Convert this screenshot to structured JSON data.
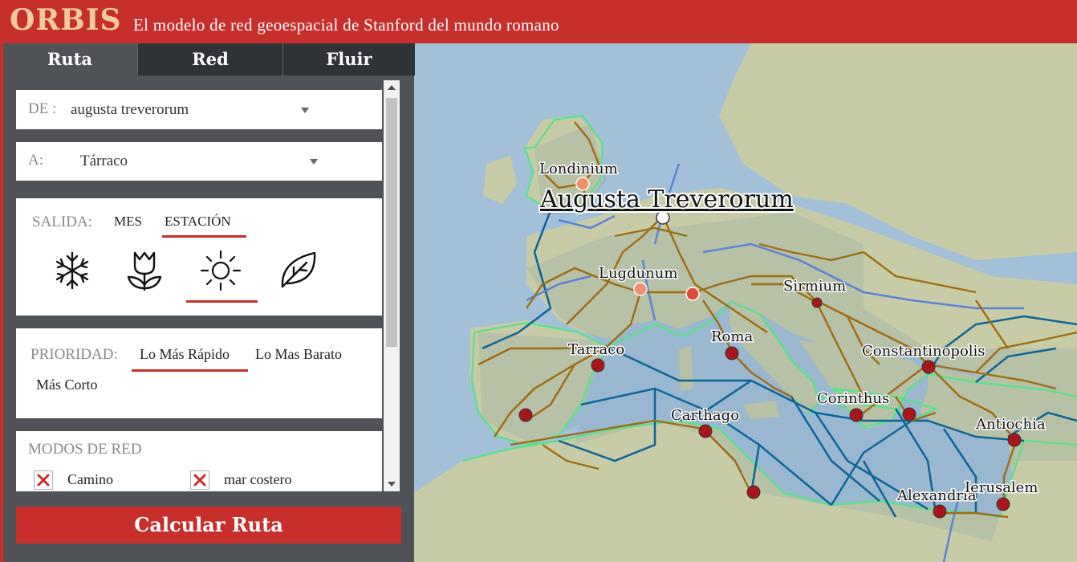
{
  "header": {
    "logo": "ORBIS",
    "subtitle": "El modelo de red geoespacial de Stanford del mundo romano"
  },
  "tabs": [
    {
      "label": "Ruta",
      "active": true
    },
    {
      "label": "Red",
      "active": false
    },
    {
      "label": "Fluir",
      "active": false
    }
  ],
  "route": {
    "from_label": "DE :",
    "from_value": "augusta treverorum",
    "to_label": "A:",
    "to_value": "Tárraco"
  },
  "departure": {
    "label": "SALIDA:",
    "option_month": "MES",
    "option_season": "ESTACIÓN",
    "selected_option": "ESTACIÓN",
    "seasons": [
      "winter-icon",
      "spring-icon",
      "summer-icon",
      "autumn-icon"
    ],
    "selected_season": "summer-icon"
  },
  "priority": {
    "label": "PRIORIDAD:",
    "options": [
      "Lo Más Rápido",
      "Lo Mas Barato",
      "Más Corto"
    ],
    "selected": "Lo Más Rápido"
  },
  "network_modes": {
    "title": "MODOS DE RED",
    "items": [
      {
        "label": "Camino",
        "checked": true
      },
      {
        "label": "mar costero",
        "checked": true
      }
    ]
  },
  "calculate_button": "Calcular Ruta",
  "map": {
    "colors": {
      "sea": "#a3c0d9",
      "land": "#c7cca6",
      "roads": "#9e6c14",
      "rivers": "#5b82d6",
      "sea_routes": "#0e6496",
      "coastal_routes": "#56e389",
      "sites": "#a8161c",
      "highlight_sites": "#f08f6e"
    },
    "cities": [
      {
        "name": "Londinium"
      },
      {
        "name": "Augusta Treverorum"
      },
      {
        "name": "Lugdunum"
      },
      {
        "name": "Sirmium"
      },
      {
        "name": "Roma"
      },
      {
        "name": "Tarraco"
      },
      {
        "name": "Constantinopolis"
      },
      {
        "name": "Corinthus"
      },
      {
        "name": "Carthago"
      },
      {
        "name": "Antiochia"
      },
      {
        "name": "Alexandria"
      },
      {
        "name": "Ierusalem"
      }
    ]
  }
}
